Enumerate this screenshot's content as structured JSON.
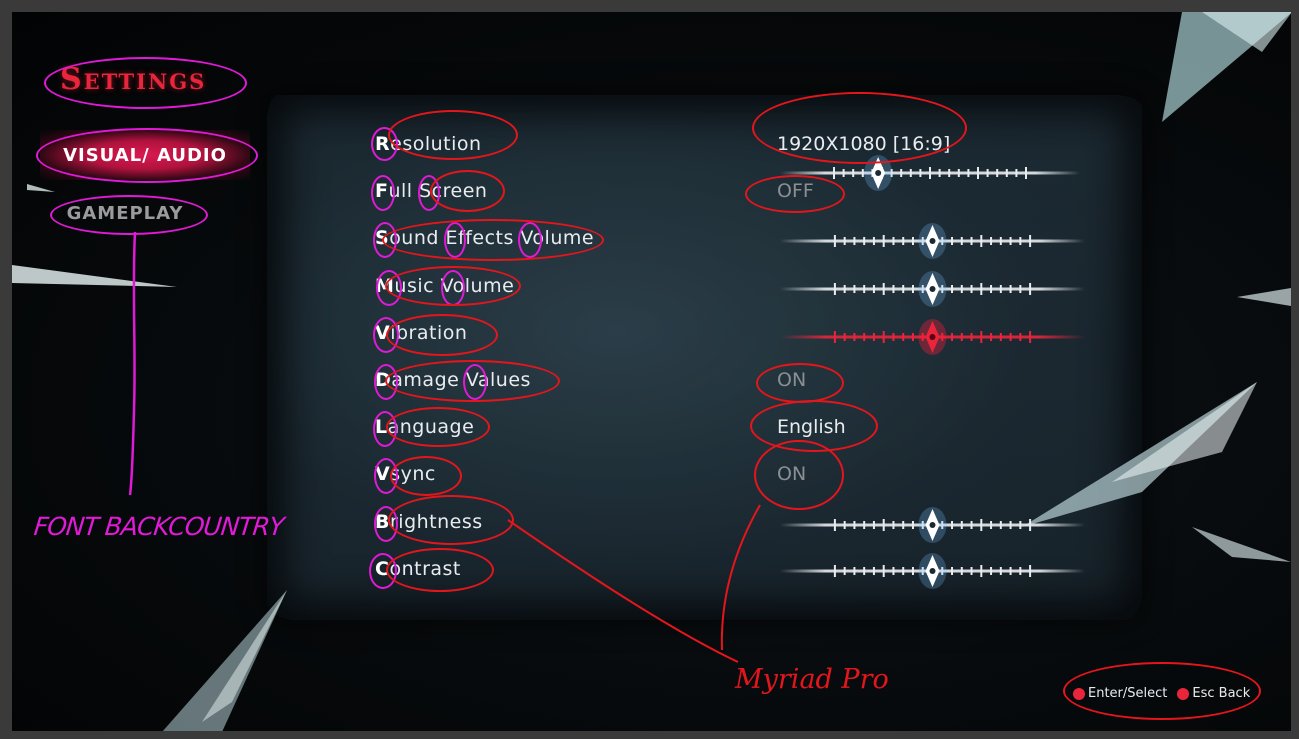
{
  "menu": {
    "title": "Settings",
    "tabs": [
      {
        "label": "VISUAL/ AUDIO",
        "active": true
      },
      {
        "label": "GAMEPLAY",
        "active": false
      }
    ]
  },
  "annotations": {
    "font_note": "FONT BACKCOUNTRY",
    "body_font_note": "Myriad Pro"
  },
  "settings": [
    {
      "first": "R",
      "rest": "esolution",
      "value": "1920X1080 [16:9]",
      "control": "text+slider",
      "level": 0.23
    },
    {
      "first": "F",
      "rest": "ull Screen",
      "value": "OFF",
      "control": "text"
    },
    {
      "first": "S",
      "rest": "ound Effects Volume",
      "control": "slider",
      "level": 0.5
    },
    {
      "first": "M",
      "rest": "usic Volume",
      "control": "slider",
      "level": 0.5
    },
    {
      "first": "V",
      "rest": "ibration",
      "control": "slider",
      "level": 0.5,
      "highlighted": true
    },
    {
      "first": "D",
      "rest": "amage Values",
      "value": "ON",
      "control": "text"
    },
    {
      "first": "L",
      "rest": "anguage",
      "value": "English",
      "control": "text"
    },
    {
      "first": "V",
      "rest": "sync",
      "value": "ON",
      "control": "text"
    },
    {
      "first": "B",
      "rest": "rightness",
      "control": "slider",
      "level": 0.5
    },
    {
      "first": "C",
      "rest": "ontrast",
      "control": "slider",
      "level": 0.5
    }
  ],
  "footer": {
    "enter_label": "Enter/Select",
    "back_label": "Esc Back"
  },
  "colors": {
    "accent_red": "#e8253b",
    "annotation_magenta": "#e01ad6",
    "annotation_red": "#e4161c",
    "text": "#e9ecef"
  }
}
